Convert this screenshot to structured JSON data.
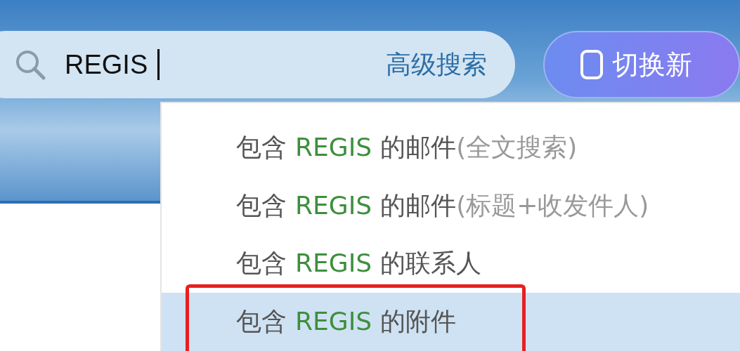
{
  "search": {
    "value": "REGIS",
    "advanced_link": "高级搜索"
  },
  "switch_button": {
    "label": "切换新"
  },
  "suggestions": [
    {
      "prefix": "包含",
      "keyword": "REGIS",
      "suffix": "的邮件",
      "note": "(全文搜索)",
      "selected": false,
      "marked": false
    },
    {
      "prefix": "包含",
      "keyword": "REGIS",
      "suffix": "的邮件",
      "note": "(标题+收发件人)",
      "selected": false,
      "marked": false
    },
    {
      "prefix": "包含",
      "keyword": "REGIS",
      "suffix": "的联系人",
      "selected": false,
      "marked": false
    },
    {
      "prefix": "包含",
      "keyword": "REGIS",
      "suffix": "的附件",
      "selected": true,
      "marked": true
    }
  ]
}
